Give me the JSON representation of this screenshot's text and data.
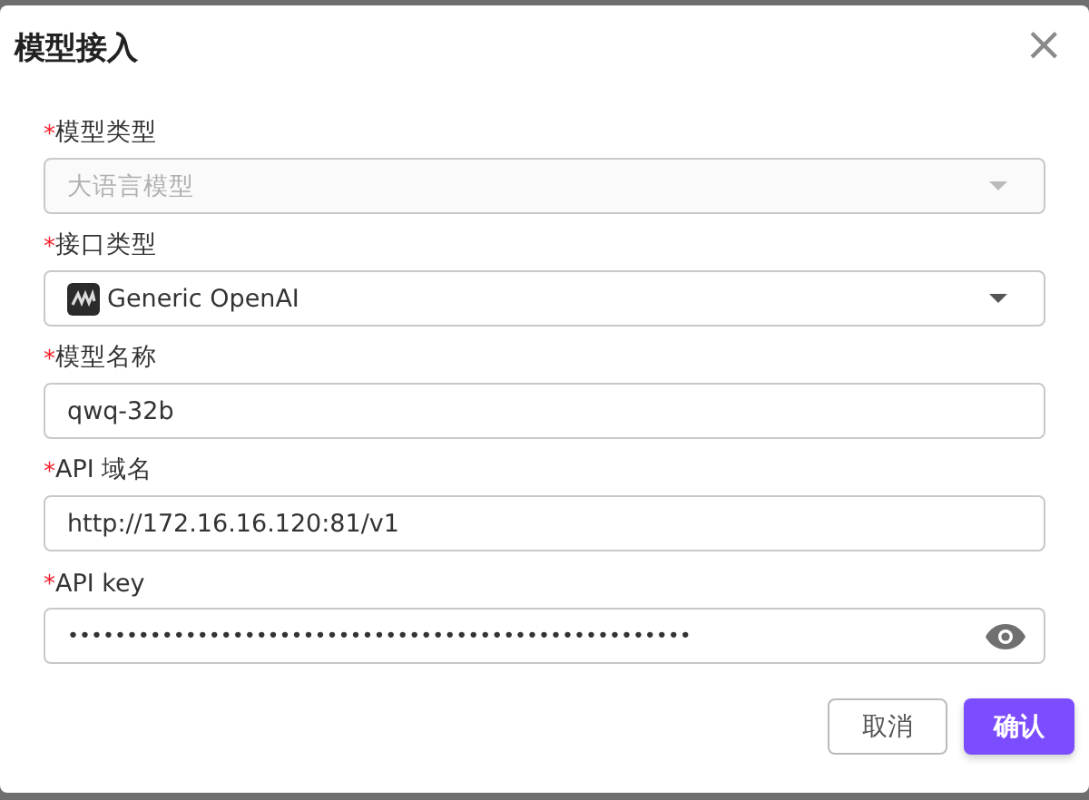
{
  "dialog": {
    "title": "模型接入",
    "close": "×"
  },
  "fields": [
    {
      "kind": "select",
      "required_mark": "*",
      "label": "模型类型",
      "value": "大语言模型",
      "disabled": true
    },
    {
      "kind": "select",
      "required_mark": "*",
      "label": "接口类型",
      "value": "Generic OpenAI",
      "disabled": false,
      "has_icon": true
    },
    {
      "kind": "text",
      "required_mark": "*",
      "label": "模型名称",
      "value": "qwq-32b",
      "disabled": false
    },
    {
      "kind": "text",
      "required_mark": "*",
      "label": "API 域名",
      "value": "http://172.16.16.120:81/v1",
      "disabled": false
    },
    {
      "kind": "password",
      "required_mark": "*",
      "label": "API key",
      "value": "•••••••••••••••••••••••••••••••••••••••••••••••••••••",
      "disabled": false
    }
  ],
  "buttons": [
    {
      "label": "取消",
      "kind": "secondary"
    },
    {
      "label": "确认",
      "kind": "primary"
    }
  ]
}
